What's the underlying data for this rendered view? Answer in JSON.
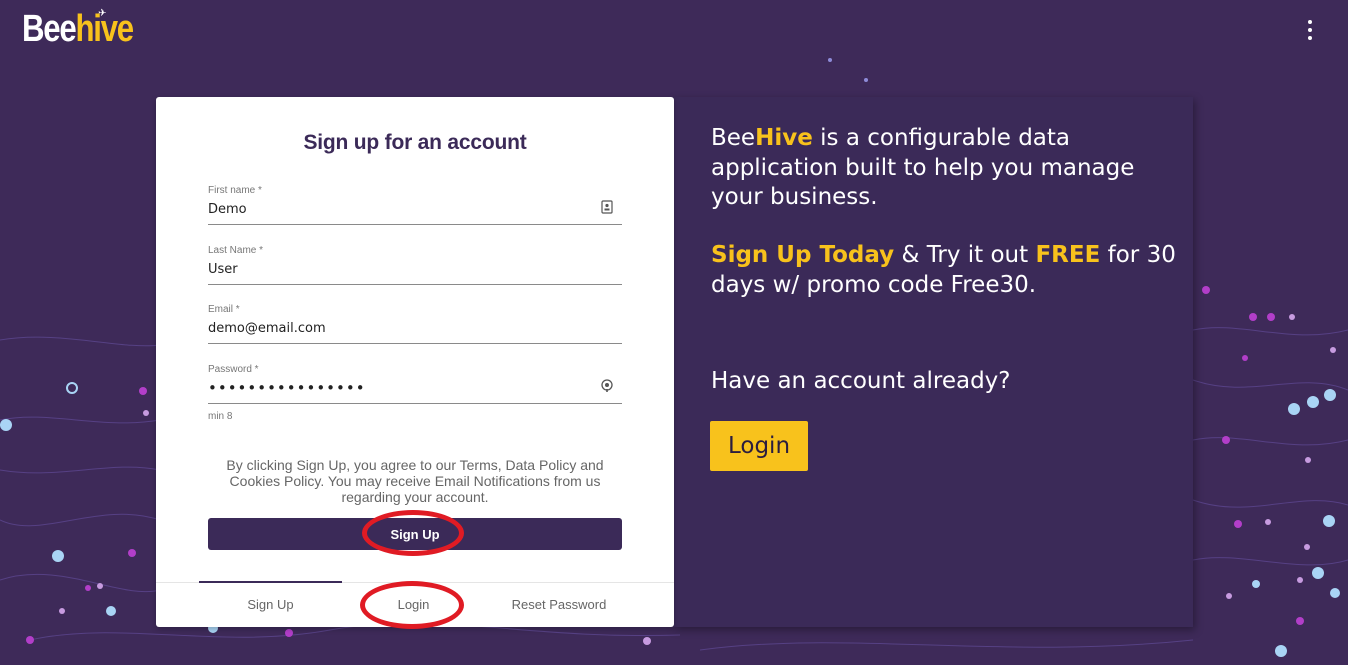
{
  "app": {
    "logo_part1": "Bee",
    "logo_part2": "hive",
    "brand_colors": {
      "purple": "#3b2a58",
      "yellow": "#f8c21c"
    }
  },
  "header": {
    "menu_icon": "kebab-menu-icon"
  },
  "form": {
    "title": "Sign up for an account",
    "fields": [
      {
        "label": "First name *",
        "value": "Demo",
        "icon": "contact-card-icon"
      },
      {
        "label": "Last Name *",
        "value": "User"
      },
      {
        "label": "Email *",
        "value": "demo@email.com"
      },
      {
        "label": "Password *",
        "value": "••••••••••••••••",
        "icon": "password-reveal-icon"
      }
    ],
    "password_hint": "min 8",
    "terms": "By clicking Sign Up, you agree to our Terms, Data Policy and Cookies Policy. You may receive Email Notifications from us regarding your account.",
    "submit_label": "Sign Up"
  },
  "tabs": [
    {
      "label": "Sign Up",
      "active": true
    },
    {
      "label": "Login",
      "active": false
    },
    {
      "label": "Reset Password",
      "active": false
    }
  ],
  "promo": {
    "line1_a": "Bee",
    "line1_b": "Hive",
    "line1_c": " is a configurable data application built to help you manage your business.",
    "offer_a": "Sign Up Today",
    "offer_b": " & Try it out ",
    "offer_c": "FREE",
    "offer_d": " for 30 days w/ promo code Free30.",
    "have_account": "Have an account already?",
    "login_label": "Login"
  }
}
